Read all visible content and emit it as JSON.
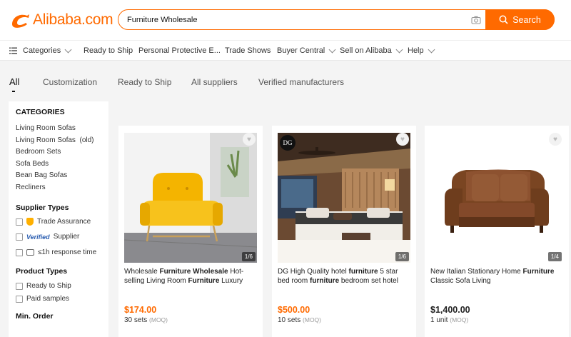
{
  "brand": {
    "logo_text": "Alibaba.com",
    "color": "#ff6a00"
  },
  "search": {
    "value": "Furniture Wholesale",
    "button_label": "Search"
  },
  "nav": {
    "categories": "Categories",
    "items": [
      "Ready to Ship",
      "Personal Protective E...",
      "Trade Shows",
      "Buyer Central",
      "Sell on Alibaba",
      "Help"
    ]
  },
  "tabs": [
    "All",
    "Customization",
    "Ready to Ship",
    "All suppliers",
    "Verified manufacturers"
  ],
  "sidebar": {
    "categories_title": "CATEGORIES",
    "categories": [
      "Living Room Sofas",
      "Living Room Sofas  (old)",
      "Bedroom Sets",
      "Sofa Beds",
      "Bean Bag Sofas",
      "Recliners"
    ],
    "supplier_types_title": "Supplier Types",
    "trade_assurance": "Trade Assurance",
    "verified_badge": "Verified",
    "supplier": "Supplier",
    "response_time": "≤1h response time",
    "product_types_title": "Product Types",
    "ready_to_ship": "Ready to Ship",
    "paid_samples": "Paid samples",
    "min_order_title": "Min. Order"
  },
  "products": [
    {
      "title_parts": [
        "Wholesale ",
        "Furniture Wholesale",
        " Hot-selling Living Room ",
        "Furniture",
        " Luxury"
      ],
      "price": "$174.00",
      "moq_value": "30 sets",
      "moq_label": "(MOQ)",
      "image_count": "1/6"
    },
    {
      "title_parts": [
        "DG High Quality hotel ",
        "furniture",
        " 5 star bed room ",
        "furniture",
        " bedroom set hotel"
      ],
      "price": "$500.00",
      "moq_value": "10 sets",
      "moq_label": "(MOQ)",
      "image_count": "1/6"
    },
    {
      "title_parts": [
        "New Italian Stationary Home ",
        "Furniture",
        " Classic Sofa Living"
      ],
      "price": "$1,400.00",
      "moq_value": "1 unit",
      "moq_label": "(MOQ)",
      "image_count": "1/4"
    }
  ]
}
